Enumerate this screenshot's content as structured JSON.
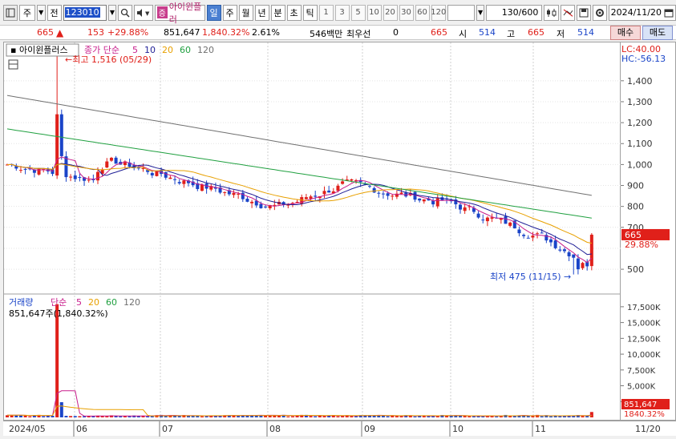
{
  "toolbar": {
    "type_label": "주",
    "scope_label": "전",
    "code_value": "123010",
    "name_badge": "증",
    "stock_name": "아이윈플러",
    "periods": [
      "일",
      "주",
      "월",
      "년",
      "분",
      "초",
      "틱"
    ],
    "intervals": [
      "1",
      "3",
      "5",
      "10",
      "20",
      "30",
      "60",
      "120"
    ],
    "count": "130/600",
    "date": "2024/11/20"
  },
  "quote": {
    "price": "665",
    "change": "153",
    "change_pct": "+29.88%",
    "volume": "851,647",
    "volume_pct": "1,840.32%",
    "turnover_pct": "2.61%",
    "amount": "546백만",
    "pref_label": "최우선",
    "pref_value": "0",
    "ask_price": "665",
    "open_label": "시",
    "open": "514",
    "high_label": "고",
    "high": "665",
    "low_label": "저",
    "low": "514",
    "buy_label": "매수",
    "sell_label": "매도"
  },
  "price_panel": {
    "stock_tag": "아이윈플러스",
    "ma_title": "종가 단순",
    "ma_periods": [
      "5",
      "10",
      "20",
      "60",
      "120"
    ],
    "ma_colors": [
      "#c81e8c",
      "#1e1e96",
      "#e8a000",
      "#20a040",
      "#707070"
    ],
    "lc": "LC:40.00",
    "hc": "HC:-56.13",
    "high_annot": "최고 1,516 (05/29)",
    "low_annot": "최저 475 (11/15)",
    "y_ticks": [
      "1,400",
      "1,300",
      "1,200",
      "1,100",
      "1,000",
      "900",
      "800",
      "700",
      "500"
    ],
    "last_price_tag": "665",
    "last_pct_tag": "29.88%"
  },
  "volume_panel": {
    "title": "거래량",
    "ma_title": "단순",
    "ma_periods": [
      "5",
      "20",
      "60",
      "120"
    ],
    "ma_colors": [
      "#c81e8c",
      "#e8a000",
      "#20a040",
      "#707070"
    ],
    "value_label": "851,647주(1,840.32%)",
    "y_ticks": [
      "17,500K",
      "15,000K",
      "12,500K",
      "10,000K",
      "7,500K",
      "5,000K",
      "2,500K"
    ],
    "last_vol_tag": "851,647",
    "last_pct_tag": "1840.32%"
  },
  "date_axis": {
    "labels": [
      "2024/05",
      "06",
      "07",
      "08",
      "09",
      "10",
      "11",
      "11/20"
    ]
  },
  "chart_data": {
    "type": "candlestick",
    "price_yrange": [
      420,
      1560
    ],
    "volume_yrange": [
      0,
      18500000
    ],
    "high_point": {
      "date": "05/29",
      "value": 1516
    },
    "low_point": {
      "date": "11/15",
      "value": 475
    },
    "last_close": 665,
    "last_volume": 851647
  }
}
